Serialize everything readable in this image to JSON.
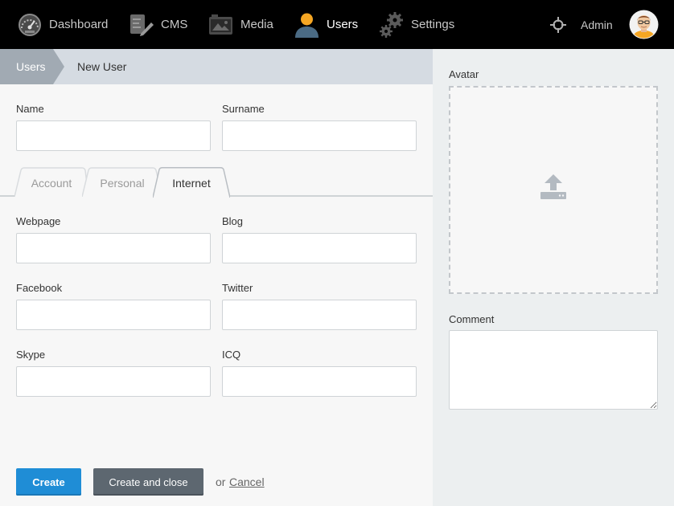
{
  "nav": {
    "items": [
      {
        "label": "Dashboard",
        "icon": "gauge-icon"
      },
      {
        "label": "CMS",
        "icon": "document-edit-icon"
      },
      {
        "label": "Media",
        "icon": "photo-icon"
      },
      {
        "label": "Users",
        "icon": "user-icon",
        "active": true
      },
      {
        "label": "Settings",
        "icon": "gears-icon"
      }
    ],
    "user_label": "Admin",
    "accent_color": "#f5a623"
  },
  "breadcrumb": {
    "parent": "Users",
    "current": "New User"
  },
  "form": {
    "name_label": "Name",
    "name_value": "",
    "surname_label": "Surname",
    "surname_value": "",
    "tabs": [
      {
        "label": "Account"
      },
      {
        "label": "Personal"
      },
      {
        "label": "Internet",
        "active": true
      }
    ],
    "webpage_label": "Webpage",
    "blog_label": "Blog",
    "facebook_label": "Facebook",
    "twitter_label": "Twitter",
    "skype_label": "Skype",
    "icq_label": "ICQ"
  },
  "actions": {
    "create_label": "Create",
    "create_close_label": "Create and close",
    "or_text": "or",
    "cancel_label": "Cancel",
    "create_color": "#1f8dd6",
    "secondary_color": "#5d6770"
  },
  "sidebar": {
    "avatar_label": "Avatar",
    "comment_label": "Comment",
    "comment_value": ""
  }
}
